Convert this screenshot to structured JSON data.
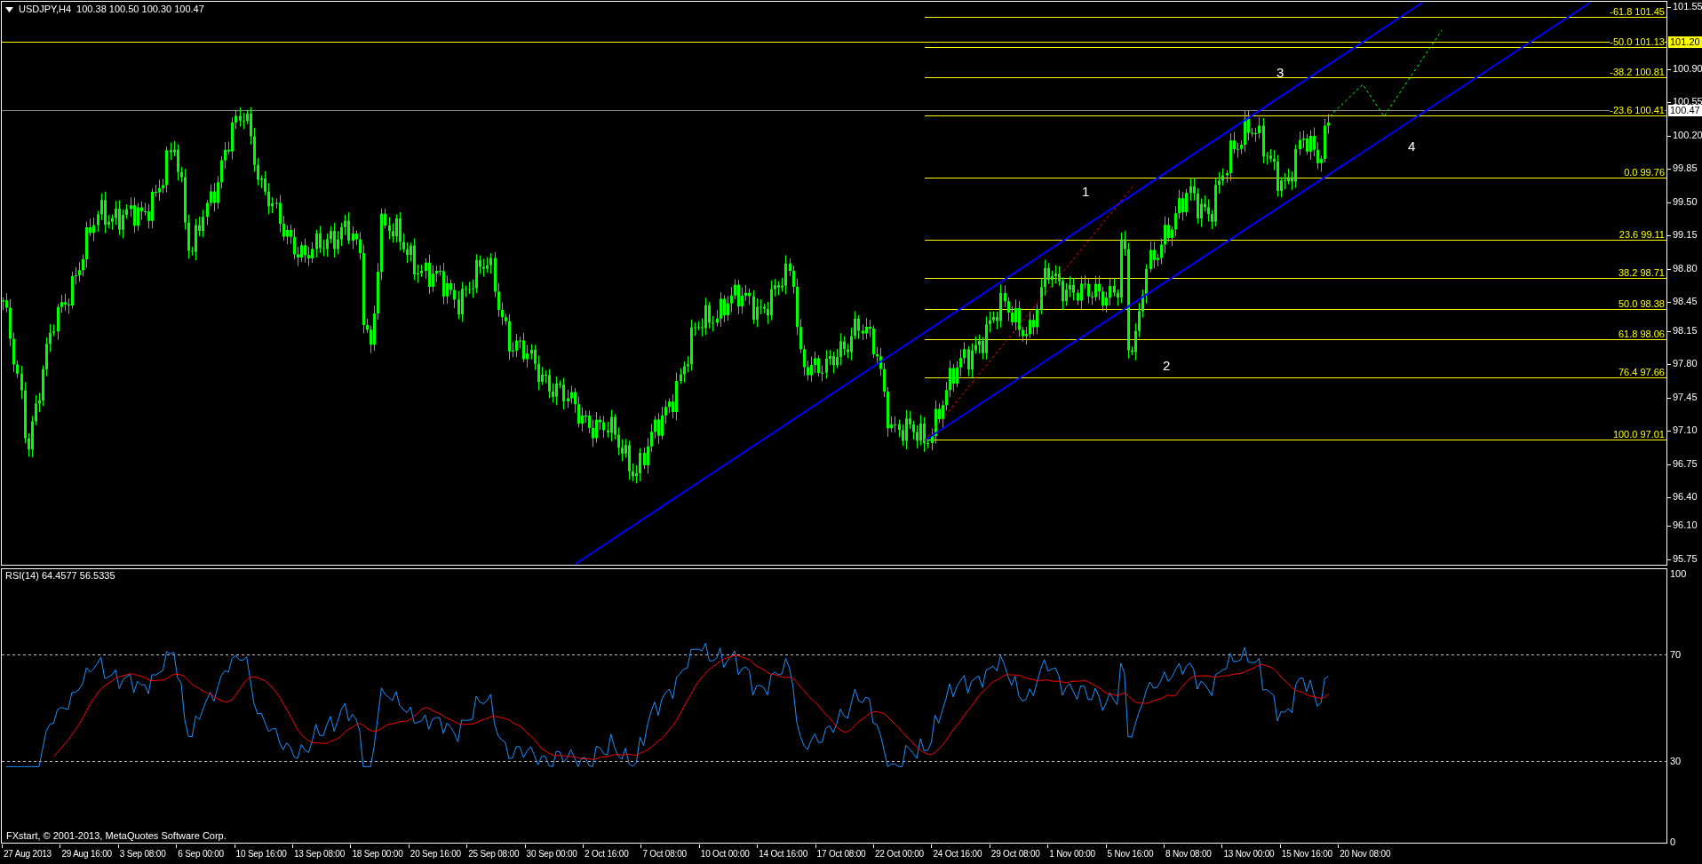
{
  "chart_header": {
    "symbol": "USDJPY,H4",
    "quotes": "100.38 100.50 100.30 100.47"
  },
  "price_axis": {
    "labels": [
      "101.55",
      "100.90",
      "100.55",
      "100.20",
      "99.85",
      "99.50",
      "99.15",
      "98.80",
      "98.45",
      "98.15",
      "97.80",
      "97.45",
      "97.10",
      "96.75",
      "96.40",
      "96.10",
      "95.75"
    ],
    "level_tag": "101.20",
    "bid_tag": "100.47"
  },
  "fibonacci_levels": [
    {
      "label": "-61.8 101.45"
    },
    {
      "label": "-50.0 101.13"
    },
    {
      "label": "-38.2 100.81"
    },
    {
      "label": "-23.6 100.41"
    },
    {
      "label": "0.0 99.76"
    },
    {
      "label": "23.6 99.11"
    },
    {
      "label": "38.2 98.71"
    },
    {
      "label": "50.0 98.38"
    },
    {
      "label": "61.8 98.06"
    },
    {
      "label": "76.4 97.66"
    },
    {
      "label": "100.0 97.01"
    }
  ],
  "wave_labels": [
    "1",
    "2",
    "3",
    "4"
  ],
  "rsi_pane": {
    "title": "RSI(14) 64.4577 56.5335",
    "axis_labels": [
      "100",
      "70",
      "30",
      "0"
    ]
  },
  "copyright": "FXstart, © 2001-2013, MetaQuotes Software Corp.",
  "time_axis": [
    "27 Aug 2013",
    "29 Aug 16:00",
    "3 Sep 08:00",
    "6 Sep 00:00",
    "10 Sep 16:00",
    "13 Sep 08:00",
    "18 Sep 00:00",
    "20 Sep 16:00",
    "25 Sep 08:00",
    "30 Sep 00:00",
    "2 Oct 16:00",
    "7 Oct 08:00",
    "10 Oct 00:00",
    "14 Oct 16:00",
    "17 Oct 08:00",
    "22 Oct 00:00",
    "24 Oct 16:00",
    "29 Oct 08:00",
    "1 Nov 00:00",
    "5 Nov 16:00",
    "8 Nov 08:00",
    "13 Nov 00:00",
    "15 Nov 16:00",
    "20 Nov 08:00"
  ]
}
